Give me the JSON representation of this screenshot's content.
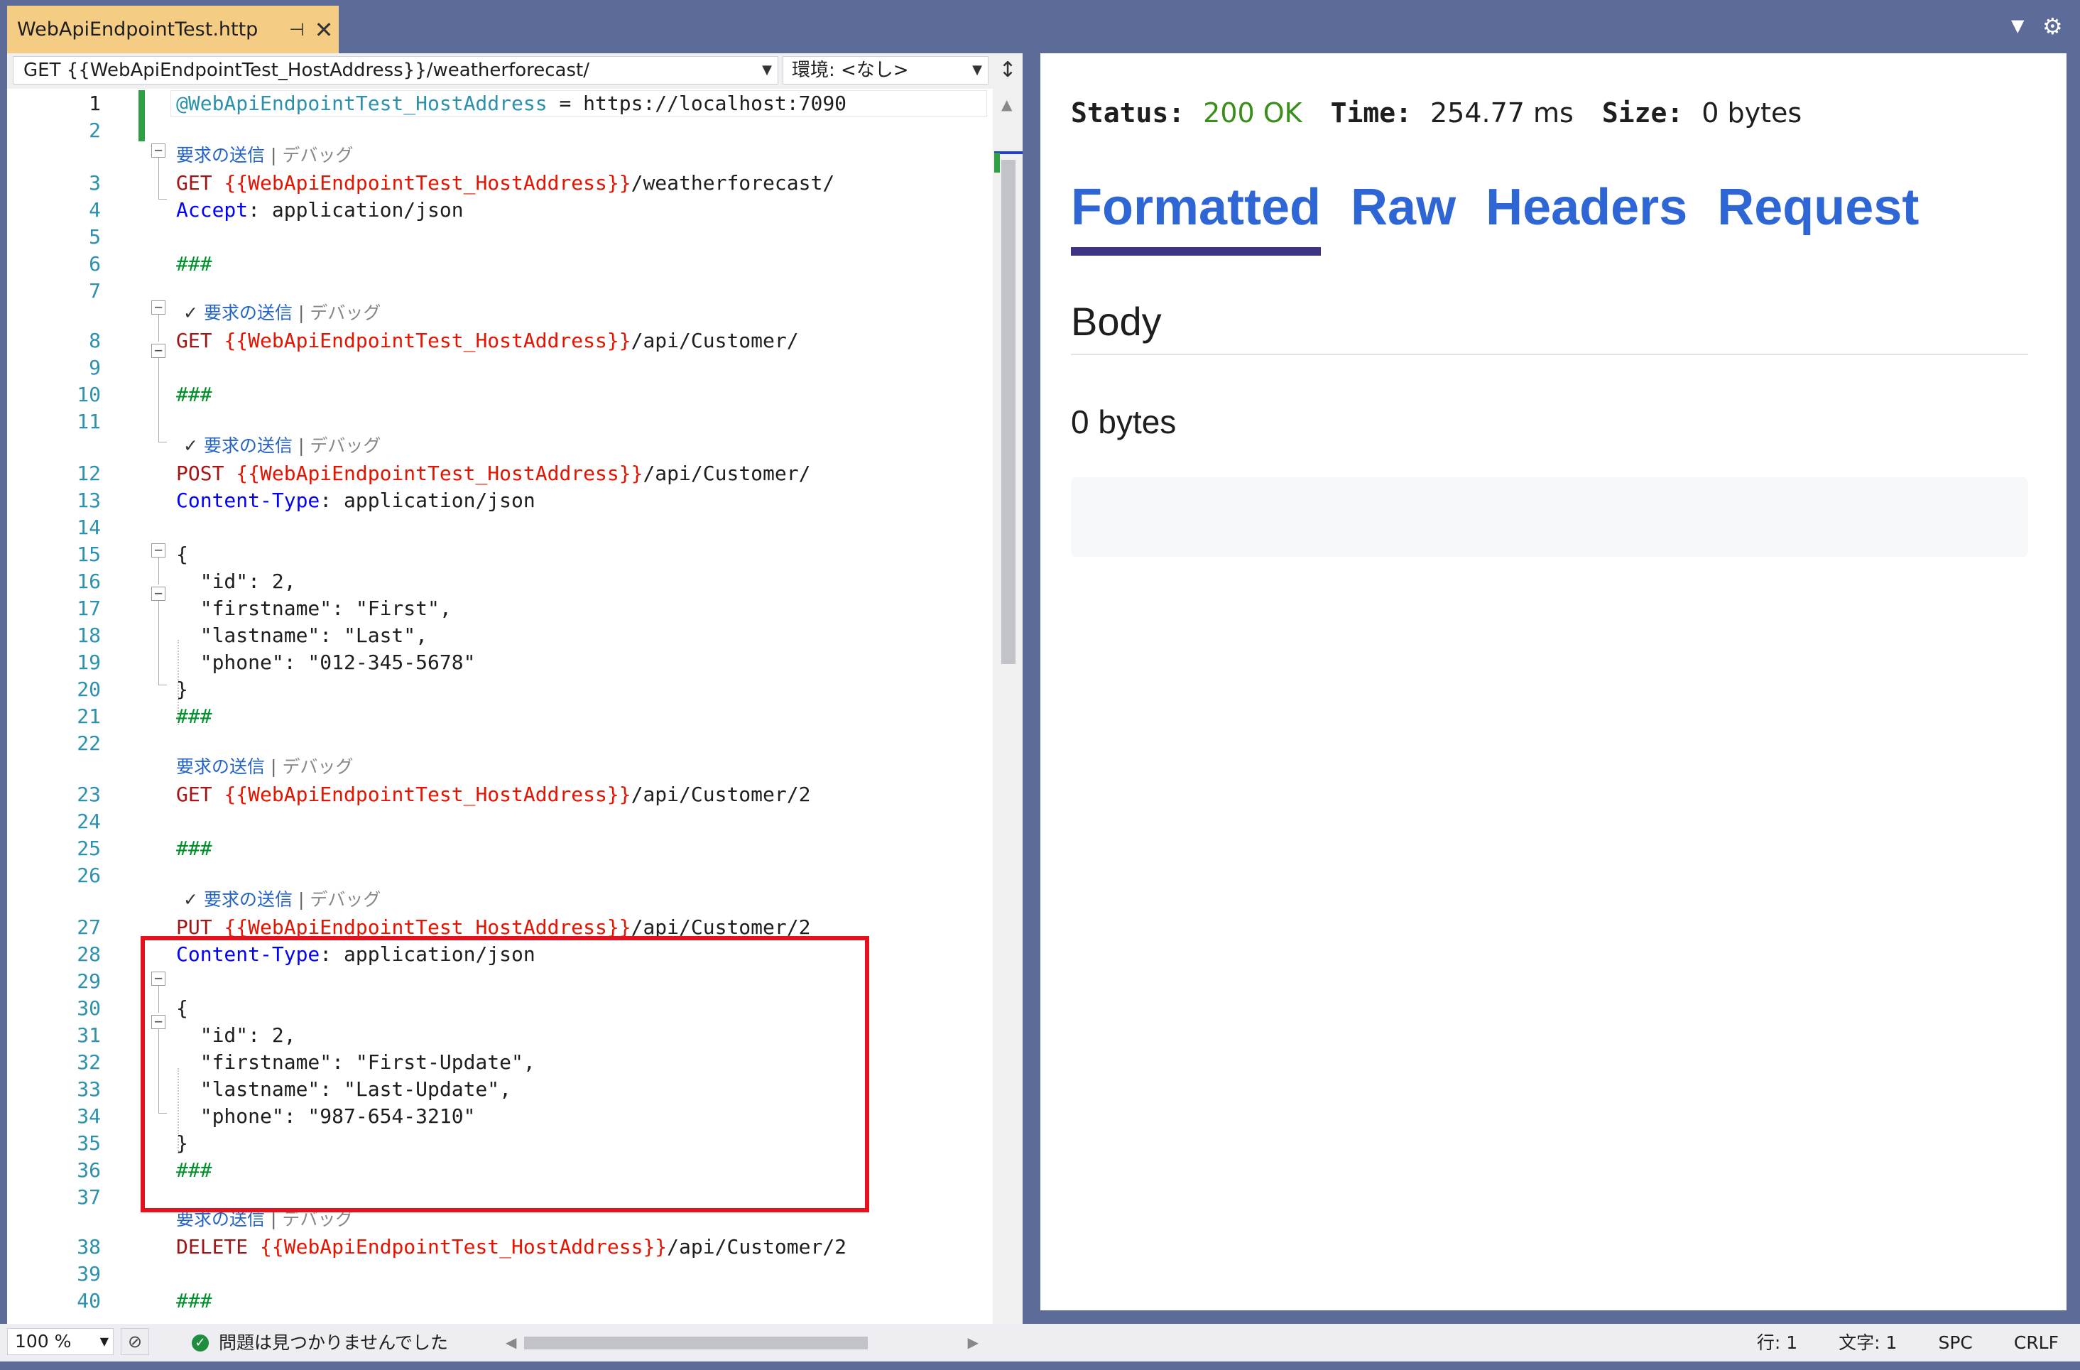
{
  "tab": {
    "filename": "WebApiEndpointTest.http",
    "pin_icon": "pin-icon",
    "close_icon": "close-icon"
  },
  "toolbar": {
    "request_selector": "GET {{WebApiEndpointTest_HostAddress}}/weatherforecast/",
    "environment_selector": "環境: <なし>"
  },
  "codelens": {
    "send": "要求の送信",
    "separator": "|",
    "debug": "デバッグ"
  },
  "line_numbers": [
    "1",
    "2",
    "3",
    "4",
    "5",
    "6",
    "7",
    "8",
    "9",
    "10",
    "11",
    "12",
    "13",
    "14",
    "15",
    "16",
    "17",
    "18",
    "19",
    "20",
    "21",
    "22",
    "23",
    "24",
    "25",
    "26",
    "27",
    "28",
    "29",
    "30",
    "31",
    "32",
    "33",
    "34",
    "35",
    "36",
    "37",
    "38",
    "39",
    "40"
  ],
  "code": {
    "l1_var": "@WebApiEndpointTest_HostAddress",
    "l1_rest": " = https://localhost:7090",
    "l3_method": "GET ",
    "host_var": "{{WebApiEndpointTest_HostAddress}}",
    "l3_path": "/weatherforecast/",
    "l4_header": "Accept",
    "l4_value": ": application/json",
    "sep": "###",
    "l8_method": "GET ",
    "l8_path": "/api/Customer/",
    "l12_method": "POST ",
    "l12_path": "/api/Customer/",
    "content_type": "Content-Type",
    "content_type_value": ": application/json",
    "open_brace": "{",
    "close_brace": "}",
    "l16": "  \"id\": 2,",
    "l17": "  \"firstname\": \"First\",",
    "l18": "  \"lastname\": \"Last\",",
    "l19": "  \"phone\": \"012-345-5678\"",
    "l23_method": "GET ",
    "l23_path": "/api/Customer/2",
    "l27_method": "PUT ",
    "l27_path": "/api/Customer/2",
    "l31": "  \"id\": 2,",
    "l32": "  \"firstname\": \"First-Update\",",
    "l33": "  \"lastname\": \"Last-Update\",",
    "l34": "  \"phone\": \"987-654-3210\"",
    "l38_method": "DELETE ",
    "l38_path": "/api/Customer/2"
  },
  "statusbar": {
    "zoom": "100 %",
    "issues": "問題は見つかりませんでした",
    "line": "行: 1",
    "column": "文字: 1",
    "whitespace": "SPC",
    "line_ending": "CRLF"
  },
  "response": {
    "status_label": "Status:",
    "status_value": "200 OK",
    "time_label": "Time:",
    "time_value": "254.77 ms",
    "size_label": "Size:",
    "size_value": "0 bytes",
    "tabs": [
      "Formatted",
      "Raw",
      "Headers",
      "Request"
    ],
    "active_tab": "Formatted",
    "body_heading": "Body",
    "body_size": "0 bytes"
  },
  "colors": {
    "tab_active": "#f5cc84",
    "frame": "#5d6b99",
    "status_ok": "#3a8e1a",
    "link_blue": "#2e66d6",
    "active_underline": "#3d3483",
    "highlight_box": "#e3121e"
  }
}
